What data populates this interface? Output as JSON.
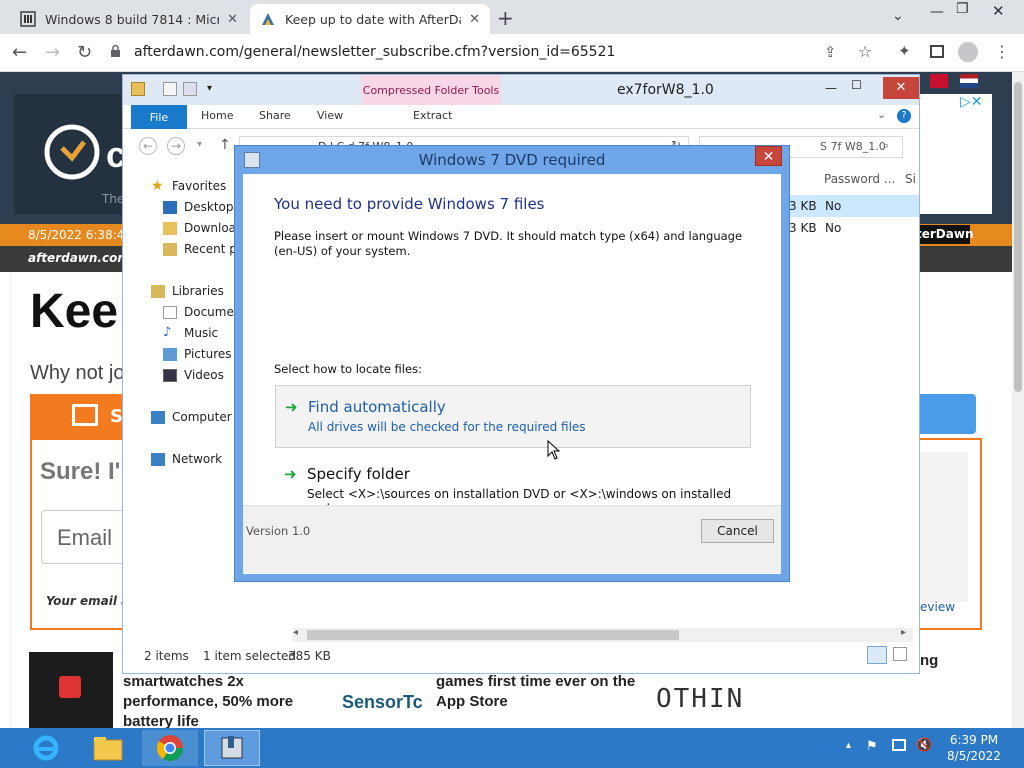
{
  "browser": {
    "tabs": [
      {
        "label": "Windows 8 build 7814 : Microsof",
        "active": false
      },
      {
        "label": "Keep up to date with AfterDawn!",
        "active": true
      }
    ],
    "url": "afterdawn.com/general/newsletter_subscribe.cfm?version_id=65521"
  },
  "site": {
    "date": "8/5/2022 6:38:4",
    "logo_text": "afterdawn.com",
    "ad_logo": "cl",
    "ad_sub": "The",
    "brand_badge": "terDawn",
    "heading": "Kee",
    "subheading": "Why not jo",
    "signup_label": "S",
    "sure": "Sure! I'",
    "email_placeholder": "Email",
    "email_note": "Your email a",
    "review_link": "eview",
    "news1": "smartwatches 2x performance, 50% more battery life",
    "news2_brand": "SensorTc",
    "news3": "games first time ever on the App Store",
    "news4": "OTHIN",
    "news5": "ng"
  },
  "explorer": {
    "title": "ex7forW8_1.0",
    "context_tab": "Compressed Folder Tools",
    "ribbon_tabs": [
      "File",
      "Home",
      "Share",
      "View",
      "Extract"
    ],
    "search_placeholder": "S        7f W8_1.0",
    "breadcrumb": "D        l        C              d       7f   W8_1.0",
    "columns": {
      "password": "Password ...",
      "size_short": "Si"
    },
    "rows": [
      {
        "size": "3 KB",
        "password": "No"
      },
      {
        "size": "3 KB",
        "password": "No"
      }
    ],
    "nav": {
      "favorites": "Favorites",
      "desktop": "Desktop",
      "downloads": "Download",
      "recent": "Recent pla",
      "libraries": "Libraries",
      "documents": "Documen",
      "music": "Music",
      "pictures": "Pictures",
      "videos": "Videos",
      "computer": "Computer",
      "network": "Network"
    },
    "status": {
      "items": "2 items",
      "selected": "1 item selected",
      "size": "385 KB"
    }
  },
  "dialog": {
    "title": "Windows 7 DVD required",
    "heading": "You need to provide Windows 7 files",
    "description": "Please insert or mount Windows 7 DVD. It should match type (x64) and language (en-US) of your system.",
    "select_label": "Select how to locate files:",
    "option1_title": "Find automatically",
    "option1_sub": "All drives will be checked for the required files",
    "option2_title": "Specify folder",
    "option2_sub": "Select <X>:\\sources on installation DVD or <X>:\\windows on installed system",
    "version": "Version 1.0",
    "cancel": "Cancel"
  },
  "taskbar": {
    "time": "6:39 PM",
    "date": "8/5/2022"
  },
  "colors": {
    "accent": "#1979ca",
    "dialog_border": "#6ea6e8",
    "taskbar": "#2b79c7",
    "link_blue": "#1f5fa8",
    "site_orange": "#f47a20"
  }
}
